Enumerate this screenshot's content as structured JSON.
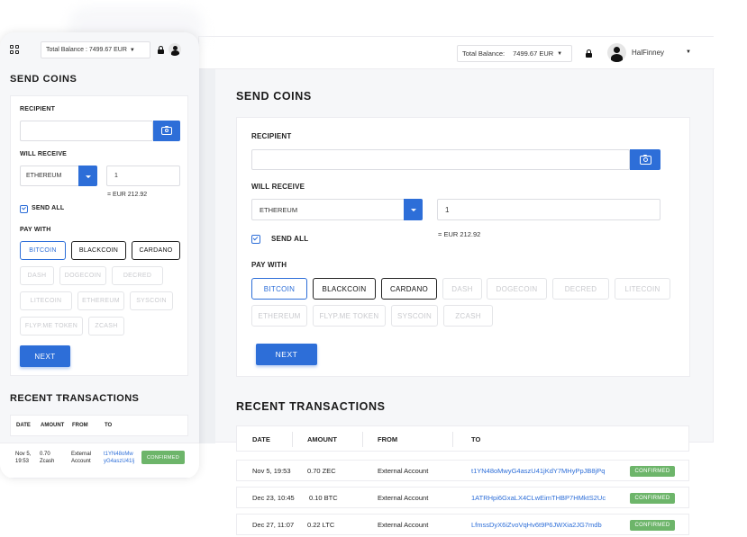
{
  "header": {
    "balance_label": "Total Balance:",
    "balance_value": "7499.67 EUR",
    "mobile_balance": "Total Balance : 7499.67 EUR",
    "username": "HalFinney"
  },
  "send": {
    "title": "SEND COINS",
    "recipient_label": "RECIPIENT",
    "recipient_value": "",
    "will_receive_label": "WILL RECEIVE",
    "currency": "ETHEREUM",
    "amount": "1",
    "equivalent": "= EUR 212.92",
    "send_all_label": "SEND ALL",
    "send_all_checked": true,
    "pay_with_label": "PAY WITH",
    "coins": [
      {
        "label": "BITCOIN",
        "state": "selected"
      },
      {
        "label": "BLACKCOIN",
        "state": "active"
      },
      {
        "label": "CARDANO",
        "state": "active"
      },
      {
        "label": "DASH",
        "state": "disabled"
      },
      {
        "label": "DOGECOIN",
        "state": "disabled"
      },
      {
        "label": "DECRED",
        "state": "disabled"
      },
      {
        "label": "LITECOIN",
        "state": "disabled"
      },
      {
        "label": "ETHEREUM",
        "state": "disabled"
      },
      {
        "label": "FLYP.ME TOKEN",
        "state": "disabled"
      },
      {
        "label": "SYSCOIN",
        "state": "disabled"
      },
      {
        "label": "ZCASH",
        "state": "disabled"
      }
    ],
    "next_label": "NEXT"
  },
  "transactions": {
    "title": "RECENT TRANSACTIONS",
    "columns": [
      "DATE",
      "AMOUNT",
      "FROM",
      "TO"
    ],
    "rows": [
      {
        "date": "Nov 5, 19:53",
        "amount": "0.70 ZEC",
        "from": "External Account",
        "to": "t1YN48oMwyG4aszU41jKdY7MHyPpJB8jPq",
        "status": "CONFIRMED"
      },
      {
        "date": "Dec 23, 10:45",
        "amount": "0.10 BTC",
        "from": "External Account",
        "to": "1ATRHpi6GxaLX4CLwEimTHBP7HMktS2Uc",
        "status": "CONFIRMED"
      },
      {
        "date": "Dec 27, 11:07",
        "amount": "0.22 LTC",
        "from": "External Account",
        "to": "LfmssDyX6iZvoVqHv6t9P6JWXia2JG7mdb",
        "status": "CONFIRMED"
      }
    ],
    "mobile_row": {
      "date_line1": "Nov 5,",
      "date_line2": "19:53",
      "amount_line1": "0.70",
      "amount_line2": "Zcash",
      "from_line1": "External",
      "from_line2": "Account",
      "to_line1": "t1YN48oMw",
      "to_line2": "yG4aszU41lj",
      "status": "CONFIRMED"
    }
  },
  "colors": {
    "accent": "#2d6ed8",
    "confirmed": "#6db56a"
  }
}
